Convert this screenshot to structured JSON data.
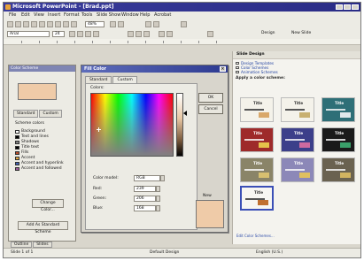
{
  "window": {
    "title": "Microsoft PowerPoint - [Brad.ppt]"
  },
  "menu": [
    "File",
    "Edit",
    "View",
    "Insert",
    "Format",
    "Tools",
    "Slide Show",
    "Window",
    "Help",
    "Acrobat"
  ],
  "toolbar": {
    "zoom": "48%",
    "font": "Arial",
    "font_size": "24",
    "design_label": "Design",
    "new_slide_label": "New Slide"
  },
  "left_panel": {
    "title": "Color Scheme",
    "tabs": [
      "Standard",
      "Custom"
    ],
    "list_title": "Scheme colors",
    "items": [
      "Background",
      "Text and lines",
      "Shadows",
      "Title text",
      "Fills",
      "Accent",
      "Accent and hyperlink",
      "Accent and followed"
    ],
    "change_button": "Change Color...",
    "add_button": "Add As Standard Scheme"
  },
  "dialog": {
    "title": "Fill Color",
    "tabs": [
      "Standard",
      "Custom"
    ],
    "colors_label": "Colors:",
    "color_model_label": "Color model:",
    "color_model": "RGB",
    "red_label": "Red:",
    "red": "239",
    "green_label": "Green:",
    "green": "206",
    "blue_label": "Blue:",
    "blue": "168",
    "ok": "OK",
    "cancel": "Cancel",
    "new_label": "New"
  },
  "right_panel": {
    "title": "Slide Design",
    "checks": [
      "Design Templates",
      "Color Schemes",
      "Animation Schemes"
    ],
    "apply_label": "Apply a color scheme:",
    "thumb_title": "Title",
    "footer_link": "Edit Color Schemes..."
  },
  "colors": {
    "preview": "#efcba8",
    "thumbs": [
      "#f4f2ea",
      "#f4f2ea",
      "#2e6f77",
      "#9e2a2a",
      "#3c3f8a",
      "#1a1a1a",
      "#8a8468",
      "#8c88b8",
      "#6a6250",
      "#f7f6f2"
    ]
  },
  "status": {
    "left": "Slide 1 of 1",
    "middle": "Default Design",
    "right": "English (U.S.)"
  },
  "view_tabs": [
    "Outline",
    "Slides"
  ]
}
